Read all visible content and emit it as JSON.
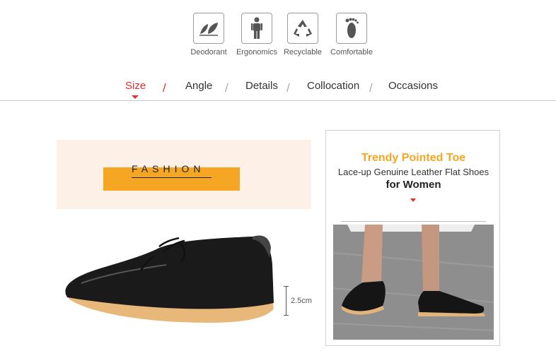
{
  "features": [
    {
      "label": "Deodorant",
      "icon": "leaf-icon"
    },
    {
      "label": "Ergonomics",
      "icon": "person-icon"
    },
    {
      "label": "Recyclable",
      "icon": "recycle-icon"
    },
    {
      "label": "Comfortable",
      "icon": "footprint-icon"
    }
  ],
  "tabs": [
    {
      "label": "Size",
      "active": true
    },
    {
      "label": "Angle",
      "active": false
    },
    {
      "label": "Details",
      "active": false
    },
    {
      "label": "Collocation",
      "active": false
    },
    {
      "label": "Occasions",
      "active": false
    }
  ],
  "tab_separator": "/",
  "banner": {
    "text": "FASHION"
  },
  "measurement": {
    "label": "2.5cm"
  },
  "product": {
    "title": "Trendy Pointed Toe",
    "subtitle": "Lace-up Genuine Leather Flat Shoes",
    "subtitle2": "for Women"
  },
  "colors": {
    "accent": "#e62e2e",
    "orange": "#f5a623",
    "banner_bg": "#fdf0e6"
  }
}
